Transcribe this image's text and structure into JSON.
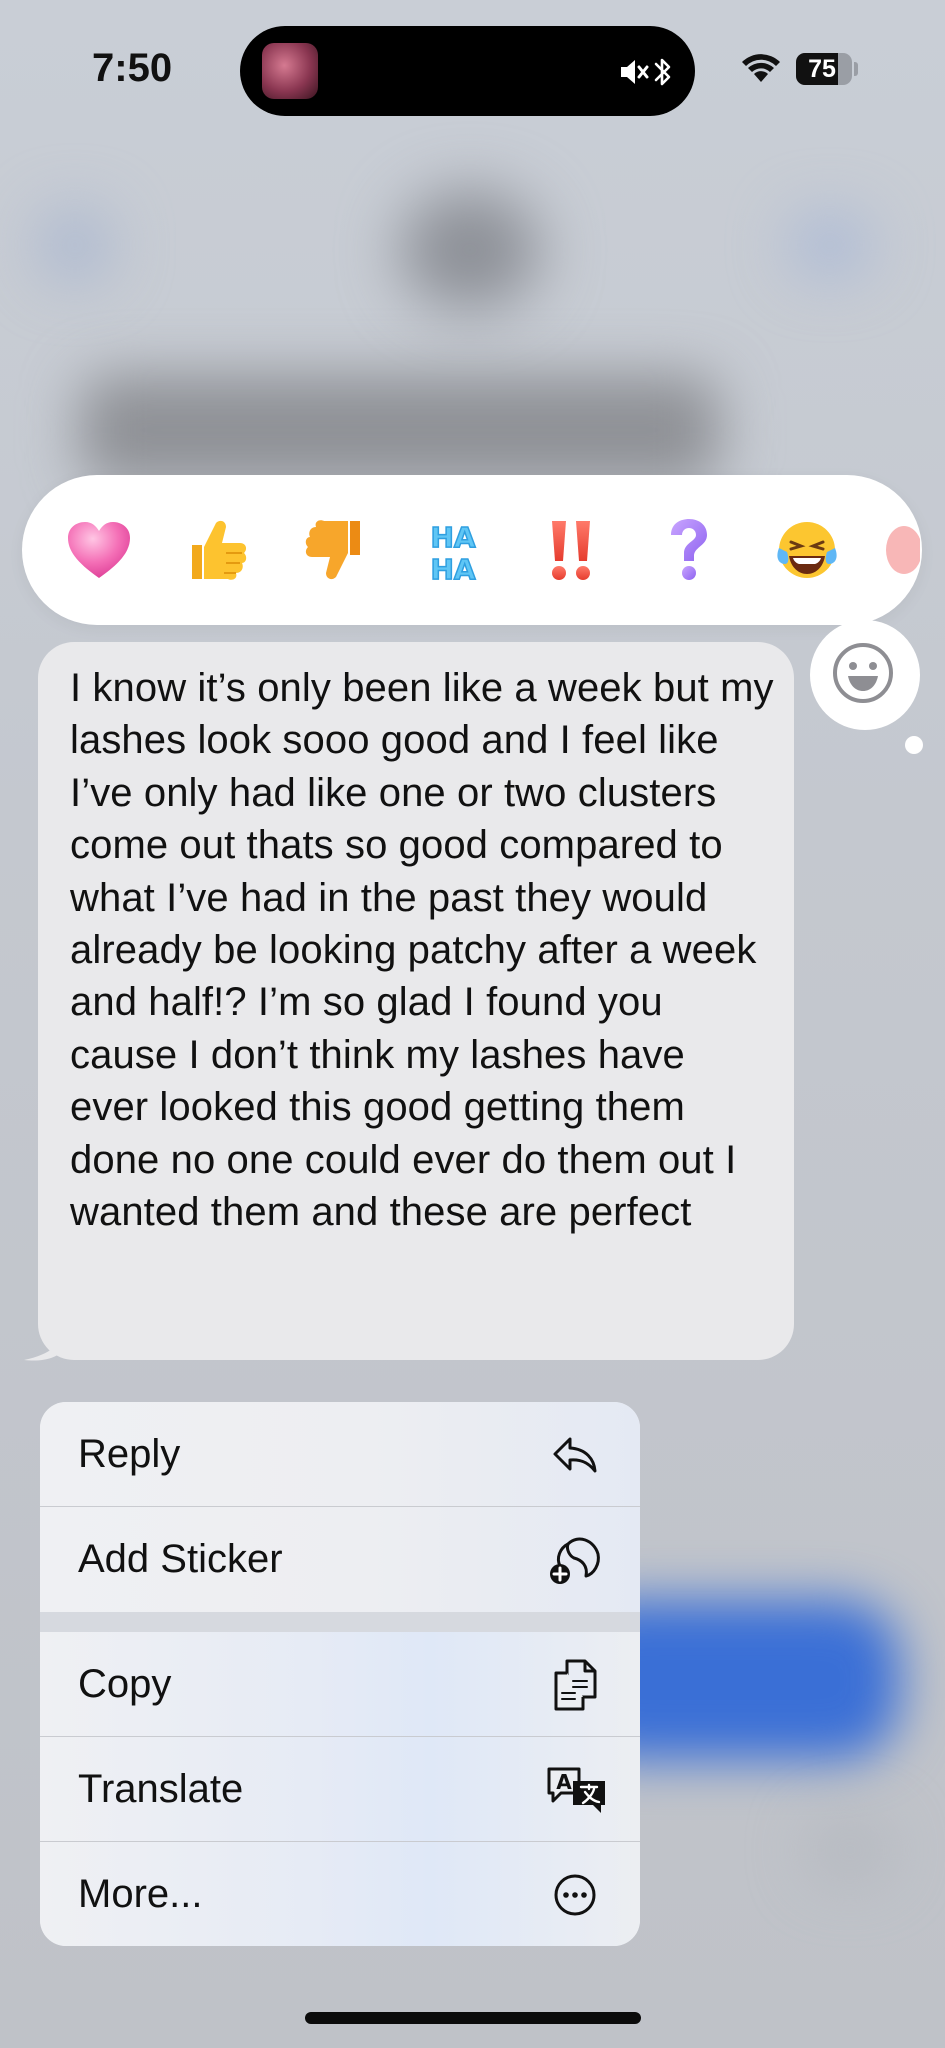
{
  "status_bar": {
    "time": "7:50",
    "battery": "75",
    "battery_level": 0.75
  },
  "reactions": [
    {
      "name": "heart",
      "glyph": "❤️"
    },
    {
      "name": "thumbs-up",
      "glyph": "👍"
    },
    {
      "name": "thumbs-down",
      "glyph": "👎"
    },
    {
      "name": "haha",
      "glyph": "HA HA"
    },
    {
      "name": "exclamation",
      "glyph": "‼️"
    },
    {
      "name": "question",
      "glyph": "?"
    },
    {
      "name": "laughing",
      "glyph": "😂"
    }
  ],
  "message": {
    "text": "I know it’s only been like a week but my lashes look sooo good and I feel like I’ve only had like one or two clusters come out thats so good compared to what I’ve had in the past they would already be looking patchy after a week and half!? I’m so glad I found you cause I don’t think my lashes have ever looked this good getting them done no one could ever do them out I wanted them and these are perfect"
  },
  "menu": {
    "reply": "Reply",
    "add_sticker": "Add Sticker",
    "copy": "Copy",
    "translate": "Translate",
    "more": "More..."
  },
  "colors": {
    "bubble_incoming": "#e9e9eb",
    "reaction_bar": "#ffffff",
    "accent_blue": "#3a6fd6"
  }
}
